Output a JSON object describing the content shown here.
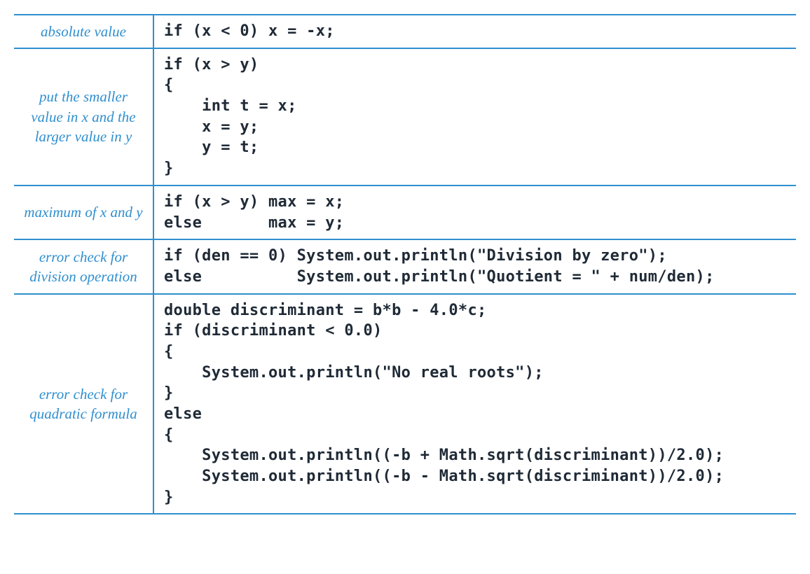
{
  "rows": [
    {
      "label": "absolute value",
      "code": "if (x < 0) x = -x;"
    },
    {
      "label": "put the smaller\nvalue in x\nand the larger\nvalue in y",
      "code": "if (x > y)\n{\n    int t = x;\n    x = y;\n    y = t;\n}"
    },
    {
      "label": "maximum of\nx and y",
      "code": "if (x > y) max = x;\nelse       max = y;"
    },
    {
      "label": "error check\nfor division\noperation",
      "code": "if (den == 0) System.out.println(\"Division by zero\");\nelse          System.out.println(\"Quotient = \" + num/den);"
    },
    {
      "label": "error check\nfor quadratic\nformula",
      "code": "double discriminant = b*b - 4.0*c;\nif (discriminant < 0.0)\n{\n    System.out.println(\"No real roots\");\n}\nelse\n{\n    System.out.println((-b + Math.sqrt(discriminant))/2.0);\n    System.out.println((-b - Math.sqrt(discriminant))/2.0);\n}"
    }
  ]
}
